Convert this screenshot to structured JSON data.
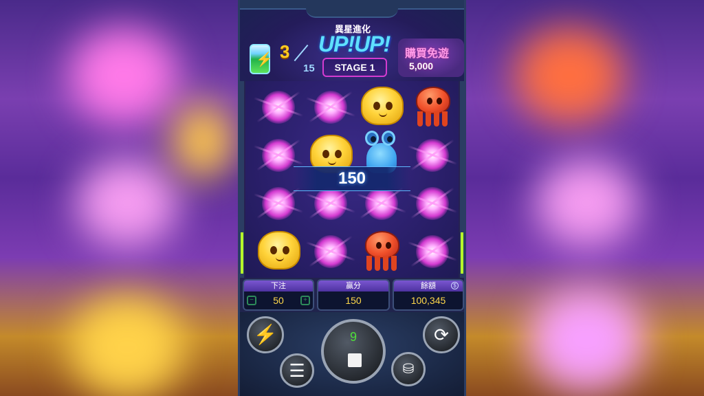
{
  "header": {
    "collect_current": "3",
    "collect_total": "15",
    "logo_chinese": "異星進化",
    "logo_text": "UP!UP!",
    "stage_label": "STAGE 1"
  },
  "buy_feature": {
    "label": "購買免遊",
    "price": "5,000"
  },
  "win_banner": {
    "amount": "150"
  },
  "panels": {
    "bet": {
      "label": "下注",
      "value": "50"
    },
    "win": {
      "label": "贏分",
      "value": "150"
    },
    "balance": {
      "label": "餘額",
      "value": "100,345"
    }
  },
  "controls": {
    "spin_count": "9"
  },
  "grid": [
    [
      "star",
      "star",
      "yellow-blob",
      "red-octopus"
    ],
    [
      "star",
      "yellow-blob",
      "blue-alien",
      "star"
    ],
    [
      "star",
      "star",
      "star",
      "star"
    ],
    [
      "yellow-blob",
      "star",
      "red-octopus",
      "star"
    ]
  ],
  "icons": {
    "turbo": "lightning-icon",
    "menu": "hamburger-menu-icon",
    "spin": "stop-square-icon",
    "auto": "autoplay-cycle-icon",
    "coins": "coin-stack-icon",
    "battery": "battery-charge-icon",
    "info": "info-icon"
  },
  "colors": {
    "accent_gold": "#ffd84a",
    "panel_header": "#7a56d0",
    "spin_count": "#4fe03a"
  }
}
